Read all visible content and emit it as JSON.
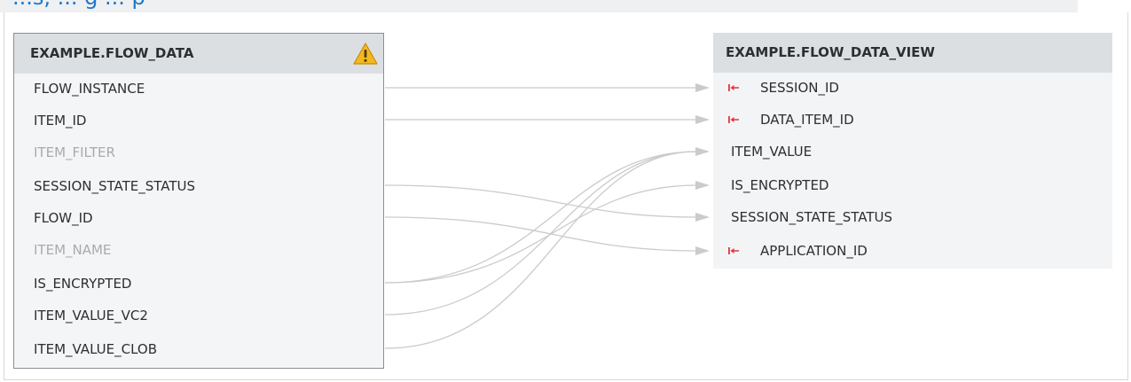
{
  "page": {
    "partial_heading": "...s, ... g ... p"
  },
  "source_table": {
    "title": "EXAMPLE.FLOW_DATA",
    "warning_icon": "warning-icon",
    "columns": [
      {
        "label": "FLOW_INSTANCE",
        "dimmed": false
      },
      {
        "label": "ITEM_ID",
        "dimmed": false
      },
      {
        "label": "ITEM_FILTER",
        "dimmed": true
      },
      {
        "label": "SESSION_STATE_STATUS",
        "dimmed": false
      },
      {
        "label": "FLOW_ID",
        "dimmed": false
      },
      {
        "label": "ITEM_NAME",
        "dimmed": true
      },
      {
        "label": "IS_ENCRYPTED",
        "dimmed": false
      },
      {
        "label": "ITEM_VALUE_VC2",
        "dimmed": false
      },
      {
        "label": "ITEM_VALUE_CLOB",
        "dimmed": false
      }
    ]
  },
  "target_table": {
    "title": "EXAMPLE.FLOW_DATA_VIEW",
    "key_icon": "key-icon",
    "key_color": "#e0383e",
    "columns": [
      {
        "label": "SESSION_ID",
        "key": true
      },
      {
        "label": "DATA_ITEM_ID",
        "key": true
      },
      {
        "label": "ITEM_VALUE",
        "key": false
      },
      {
        "label": "IS_ENCRYPTED",
        "key": false
      },
      {
        "label": "SESSION_STATE_STATUS",
        "key": false
      },
      {
        "label": "APPLICATION_ID",
        "key": true
      }
    ]
  },
  "mappings": [
    {
      "from": "FLOW_INSTANCE",
      "to": "SESSION_ID"
    },
    {
      "from": "ITEM_ID",
      "to": "DATA_ITEM_ID"
    },
    {
      "from": "SESSION_STATE_STATUS",
      "to": "SESSION_STATE_STATUS"
    },
    {
      "from": "FLOW_ID",
      "to": "APPLICATION_ID"
    },
    {
      "from": "IS_ENCRYPTED",
      "to": "ITEM_VALUE"
    },
    {
      "from": "IS_ENCRYPTED",
      "to": "IS_ENCRYPTED"
    },
    {
      "from": "ITEM_VALUE_VC2",
      "to": "ITEM_VALUE"
    },
    {
      "from": "ITEM_VALUE_CLOB",
      "to": "ITEM_VALUE"
    }
  ],
  "colors": {
    "link_line": "#c9cbcd",
    "heading_blue": "#1f78c8",
    "header_bg": "#dcdfe2",
    "warning_fill": "#f3b81f"
  }
}
